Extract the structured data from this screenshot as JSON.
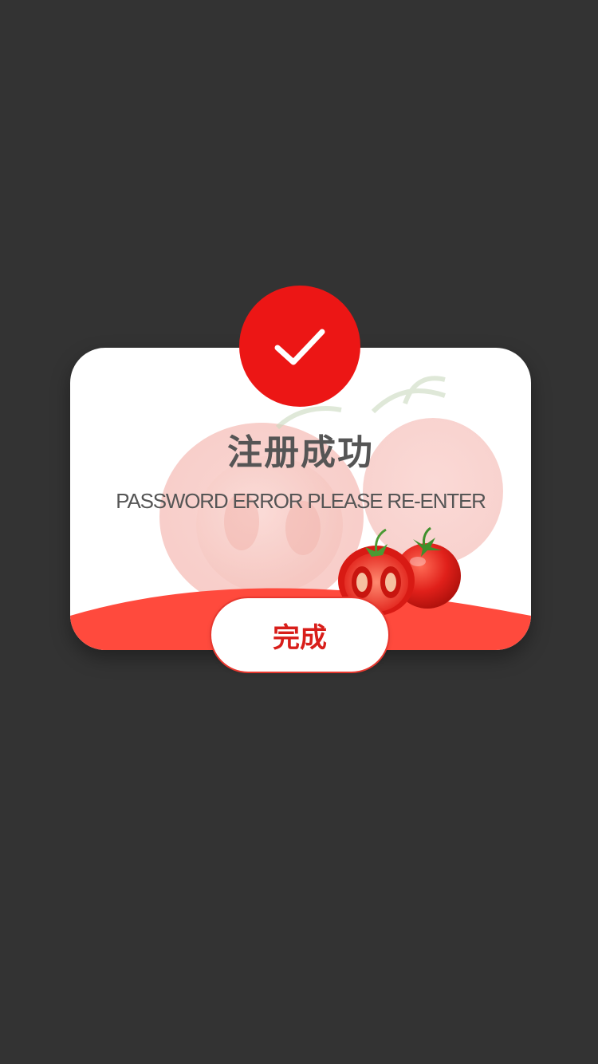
{
  "dialog": {
    "title": "注册成功",
    "subtitle": "PASSWORD ERROR PLEASE RE-ENTER",
    "button_label": "完成",
    "icon": "checkmark-icon"
  },
  "colors": {
    "backdrop": "#333333",
    "card": "#ffffff",
    "accent_red": "#ec1615",
    "wave_red": "#ff4a3d",
    "button_text": "#d81e1a",
    "text_gray": "#555555"
  }
}
